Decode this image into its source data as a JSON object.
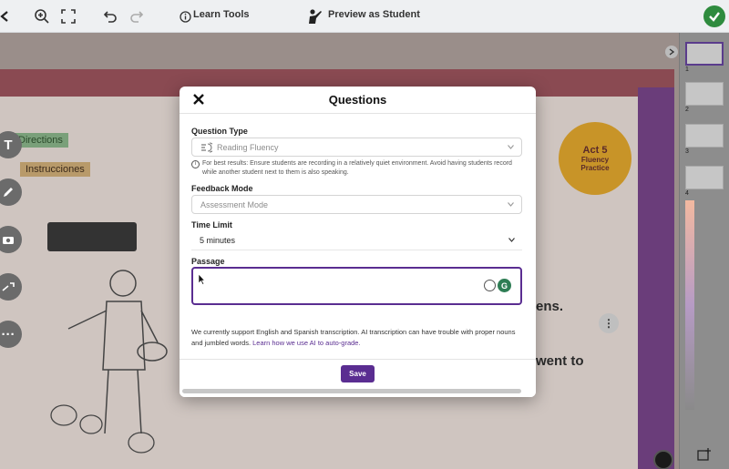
{
  "toolbar": {
    "learn_tools_label": "Learn Tools",
    "preview_label": "Preview as Student",
    "colors": {
      "done": "#2e8b3e"
    }
  },
  "slide": {
    "directions_label": "Directions",
    "instrucciones_label": "Instrucciones",
    "sun_lines": [
      "Act 5",
      "Fluency",
      "Practice"
    ],
    "text_line1": "ens.",
    "text_line2": "went to"
  },
  "thumbnails": [
    "1",
    "2",
    "3",
    "4"
  ],
  "modal": {
    "title": "Questions",
    "question_type_label": "Question Type",
    "question_type_value": "Reading Fluency",
    "hint": "For best results: Ensure students are recording in a relatively quiet environment. Avoid having students record while another student next to them is also speaking.",
    "feedback_mode_label": "Feedback Mode",
    "feedback_mode_value": "Assessment Mode",
    "time_limit_label": "Time Limit",
    "time_limit_value": "5 minutes",
    "passage_label": "Passage",
    "passage_value": "",
    "note_text": "We currently support English and Spanish transcription. AI transcription can have trouble with proper nouns and jumbled words. ",
    "note_link": "Learn how we use AI to auto-grade.",
    "save_label": "Save",
    "colors": {
      "accent": "#5a2d91"
    }
  }
}
